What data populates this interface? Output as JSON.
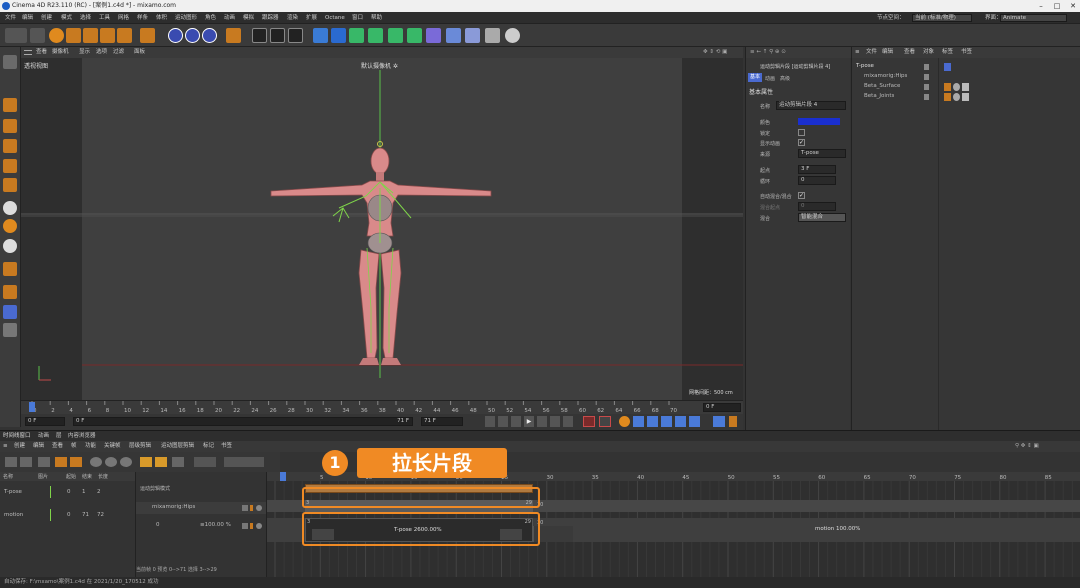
{
  "window": {
    "title": "Cinema 4D R23.110 (RC) - [案例1.c4d *] - mixamo.com"
  },
  "menu": [
    "文件",
    "编辑",
    "创建",
    "模式",
    "选择",
    "工具",
    "网格",
    "样条",
    "体积",
    "运动图形",
    "角色",
    "动画",
    "模拟",
    "跟踪器",
    "渲染",
    "扩展",
    "Octane",
    "窗口",
    "帮助"
  ],
  "layout": {
    "label": "节点空间：",
    "value": "当前 (标准/物理)",
    "interface_label": "界面：",
    "interface_value": "Animate"
  },
  "viewport": {
    "menu": [
      "查看",
      "摄像机",
      "显示",
      "选项",
      "过滤",
      "面板"
    ],
    "name": "透视视图",
    "camera": "默认摄像机 ✲",
    "grid_info": "网格间距：500 cm"
  },
  "ruler": {
    "ticks": [
      "0",
      "2",
      "4",
      "6",
      "8",
      "10",
      "12",
      "14",
      "16",
      "18",
      "20",
      "22",
      "24",
      "26",
      "28",
      "30",
      "32",
      "34",
      "36",
      "38",
      "40",
      "42",
      "44",
      "46",
      "48",
      "50",
      "52",
      "54",
      "56",
      "58",
      "60",
      "62",
      "64",
      "66",
      "68",
      "70"
    ],
    "end": "0 F"
  },
  "transport": {
    "start": "0 F",
    "cur": "0 F",
    "end": "71 F",
    "end2": "71 F"
  },
  "attributes": {
    "title": "运动剪辑片段 [运动剪辑片段 4]",
    "tabs": [
      "基本",
      "动画",
      "高级"
    ],
    "section": "基本属性",
    "rows": [
      {
        "label": "名称",
        "value": "运动剪辑片段 4"
      },
      {
        "label": "颜色",
        "value": ""
      },
      {
        "label": "锁定",
        "value": ""
      },
      {
        "label": "显示动画",
        "value": ""
      },
      {
        "label": "来源",
        "value": "T-pose"
      },
      {
        "label": "起点",
        "value": "3 F"
      },
      {
        "label": "循环",
        "value": "0"
      },
      {
        "label": "自动混合/混合",
        "value": ""
      },
      {
        "label": "混合起点",
        "value": "0"
      },
      {
        "label": "混合",
        "value": "智能混合"
      }
    ]
  },
  "objects": {
    "menu": [
      "文件",
      "编辑",
      "查看",
      "对象",
      "标签",
      "书签"
    ],
    "items": [
      "T-pose",
      "mixamorig:Hips",
      "Beta_Surface",
      "Beta_Joints"
    ]
  },
  "timeline": {
    "tabs": [
      "时间线窗口",
      "动画",
      "层",
      "内容浏览器"
    ],
    "menu": [
      "创建",
      "编辑",
      "查看",
      "帧",
      "功能",
      "关键帧",
      "层级剪辑",
      "运动图层剪辑",
      "标记",
      "书签"
    ],
    "columns": [
      "名称",
      "图片",
      "起始",
      "结束",
      "长度"
    ],
    "tracks": [
      {
        "name": "T-pose",
        "start": "0",
        "end": "1",
        "len": "2"
      },
      {
        "name": "motion",
        "start": "0",
        "end": "71",
        "len": "72"
      }
    ],
    "layer_header": "运动剪辑模式",
    "layer": "mixamorig:Hips",
    "clip_track": "0",
    "clip_pct": "≡100.00 %",
    "ruler_ticks": [
      "5",
      "10",
      "15",
      "20",
      "25",
      "30",
      "35",
      "40",
      "45",
      "50",
      "55",
      "60",
      "65",
      "70",
      "75",
      "80",
      "85",
      "90"
    ],
    "clip1_start": "3",
    "clip1_end": "29",
    "clip1_after": "30",
    "clip2_start": "3",
    "clip2_end": "29",
    "clip2_after": "30",
    "clip2_label": "T-pose  2600.00%",
    "clip3_label": "motion  100.00%",
    "status": "当前帧  0  预览  0-->71    选择  3-->29"
  },
  "annotation": {
    "number": "1",
    "text": "拉长片段"
  },
  "statusbar": "自动保存: F:\\mxamo\\案例1.c4d 在 2021/1/20_170512 成功",
  "colors": {
    "accent": "#f08a24",
    "skin": "#d98a8a",
    "bone": "#7fd44a",
    "blue": "#1f3fe0"
  }
}
